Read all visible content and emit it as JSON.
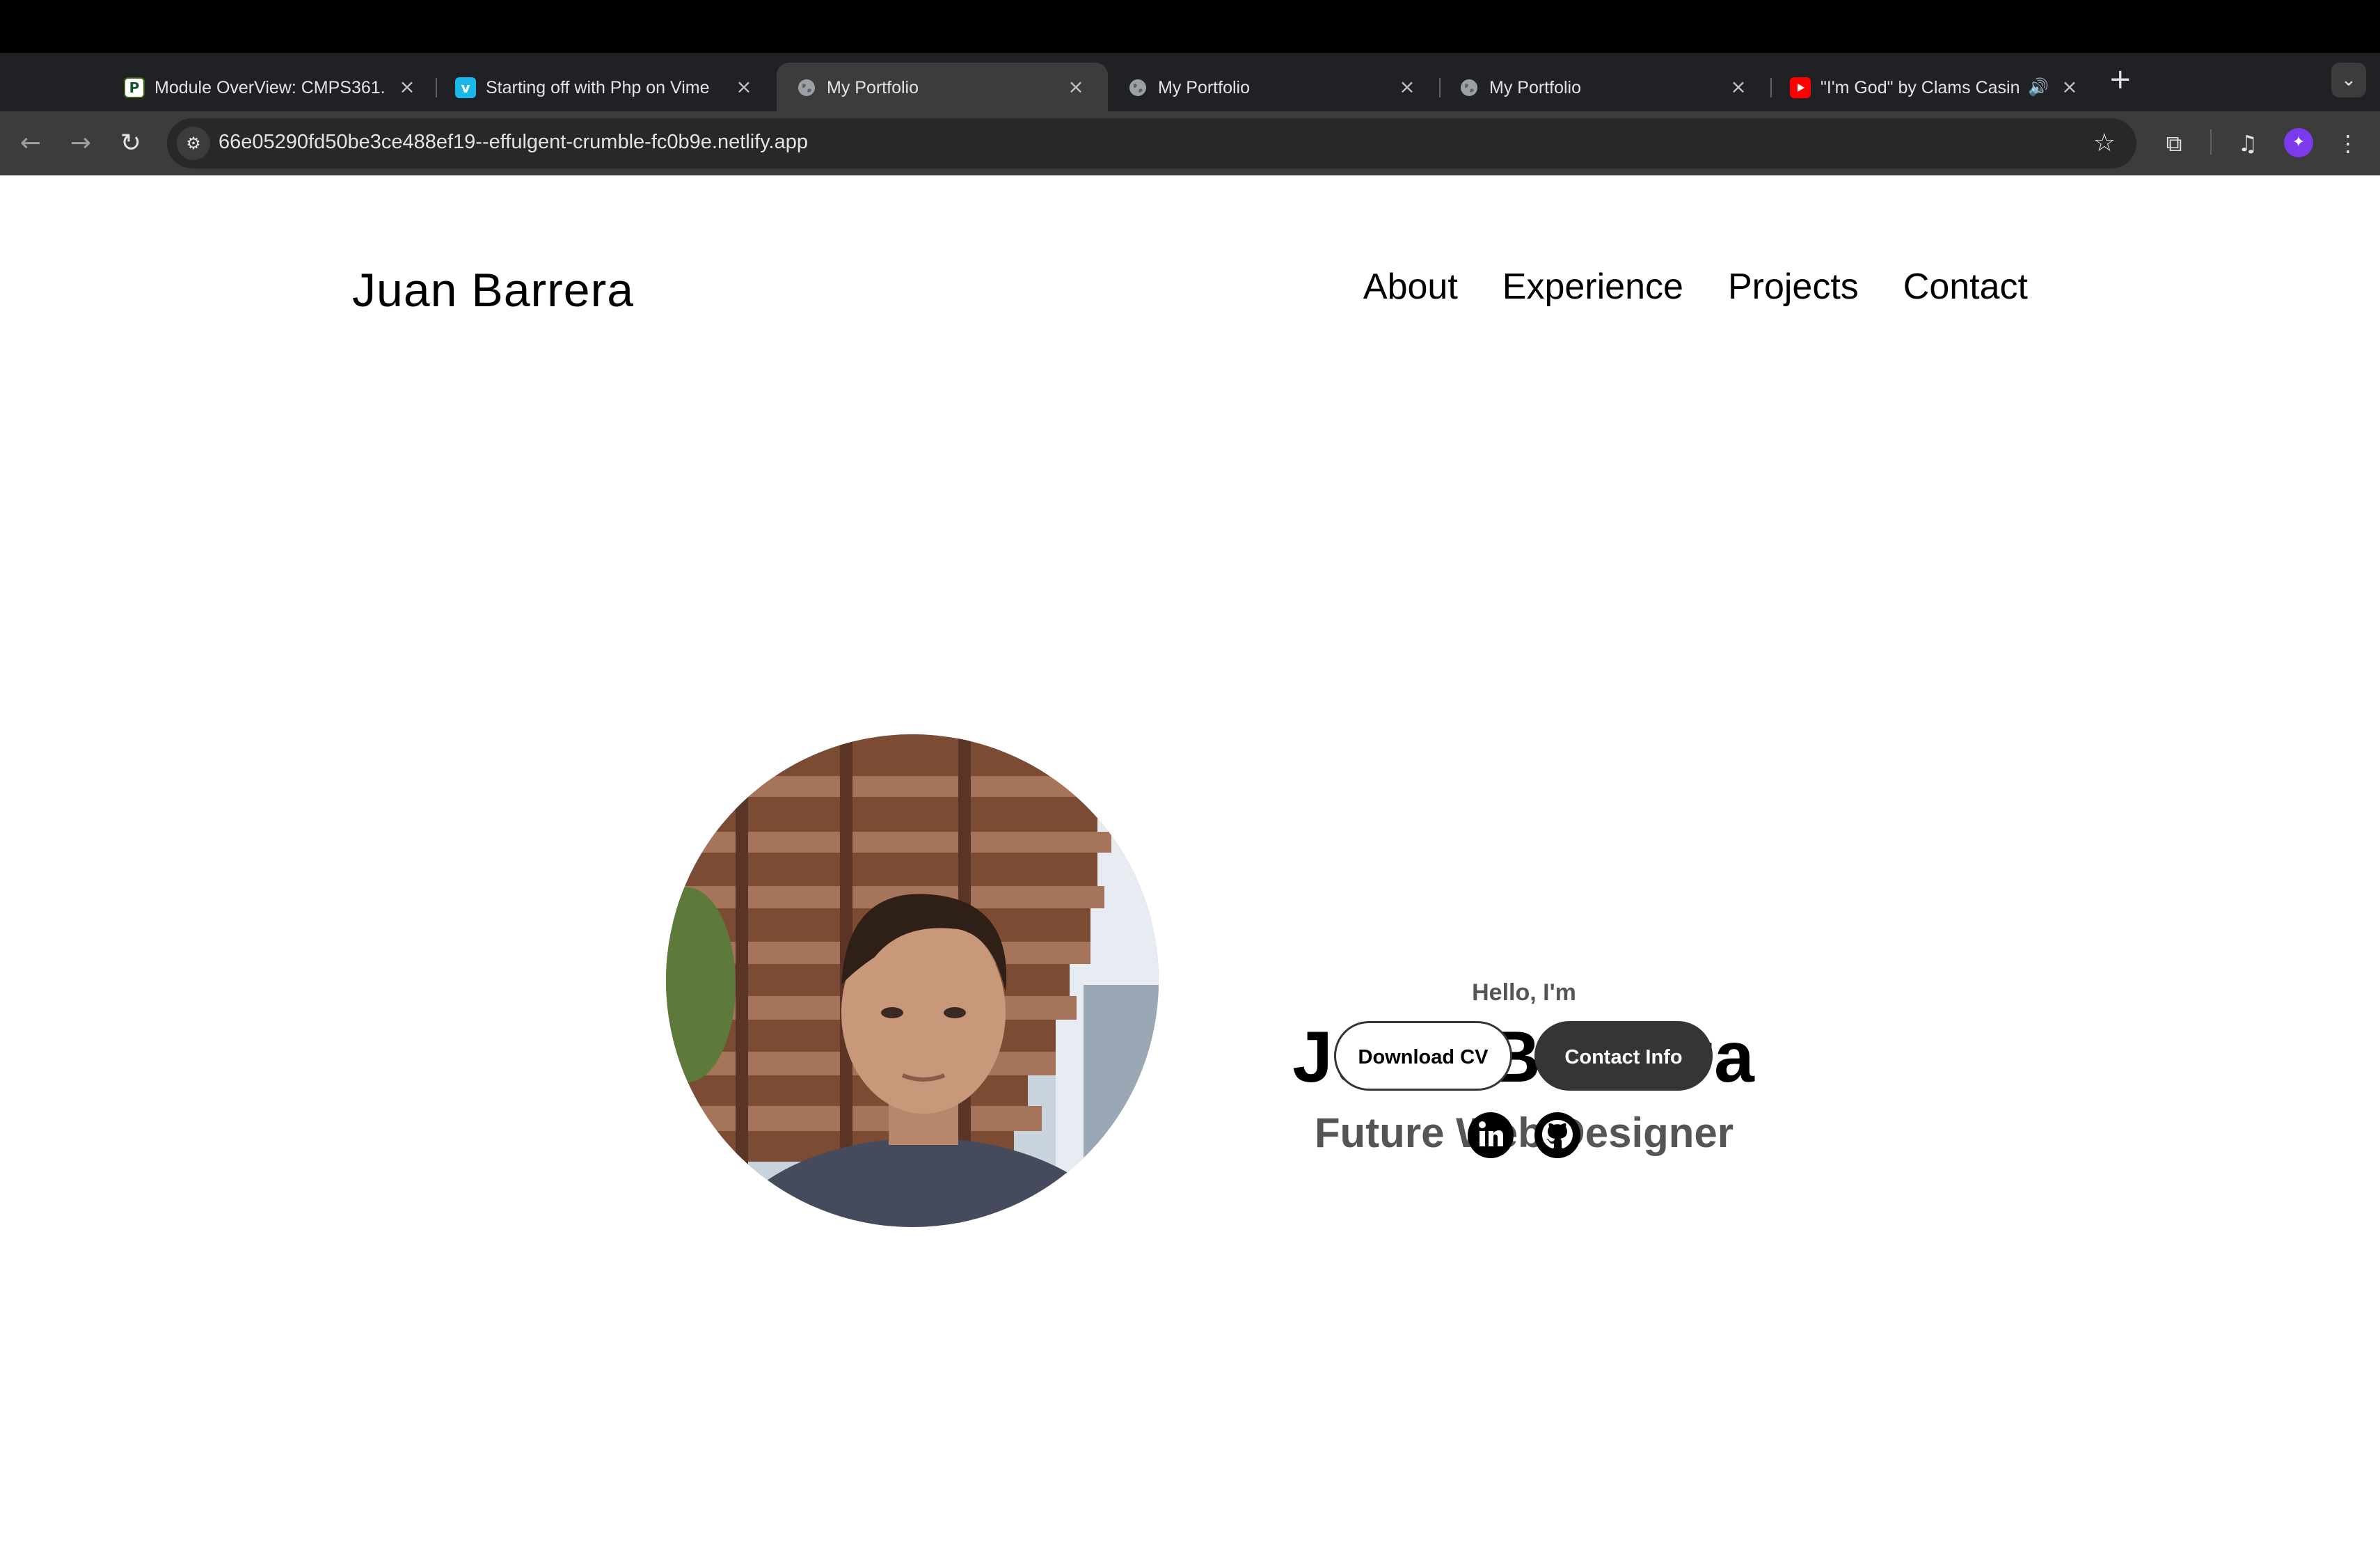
{
  "browser": {
    "tabs": [
      {
        "title": "Module OverView: CMPS361.",
        "favicon": "P",
        "active": false
      },
      {
        "title": "Starting off with Php on Vime",
        "favicon": "v",
        "active": false
      },
      {
        "title": "My Portfolio",
        "favicon": "globe",
        "active": true
      },
      {
        "title": "My Portfolio",
        "favicon": "globe",
        "active": false
      },
      {
        "title": "My Portfolio",
        "favicon": "globe",
        "active": false
      },
      {
        "title": "\"I'm God\" by Clams Casin",
        "favicon": "youtube",
        "active": false
      }
    ],
    "url": "66e05290fd50be3ce488ef19--effulgent-crumble-fc0b9e.netlify.app"
  },
  "site": {
    "logo": "Juan Barrera",
    "nav": [
      "About",
      "Experience",
      "Projects",
      "Contact"
    ]
  },
  "hero": {
    "greeting": "Hello, I'm",
    "name": "Juan Barrera",
    "role": "Future Web Designer",
    "buttons": {
      "download_cv": "Download CV",
      "contact_info": "Contact Info"
    },
    "social": [
      "linkedin",
      "github"
    ]
  },
  "colors": {
    "accent": "#353535",
    "subtext": "#555555",
    "browser_bg": "#202124"
  }
}
